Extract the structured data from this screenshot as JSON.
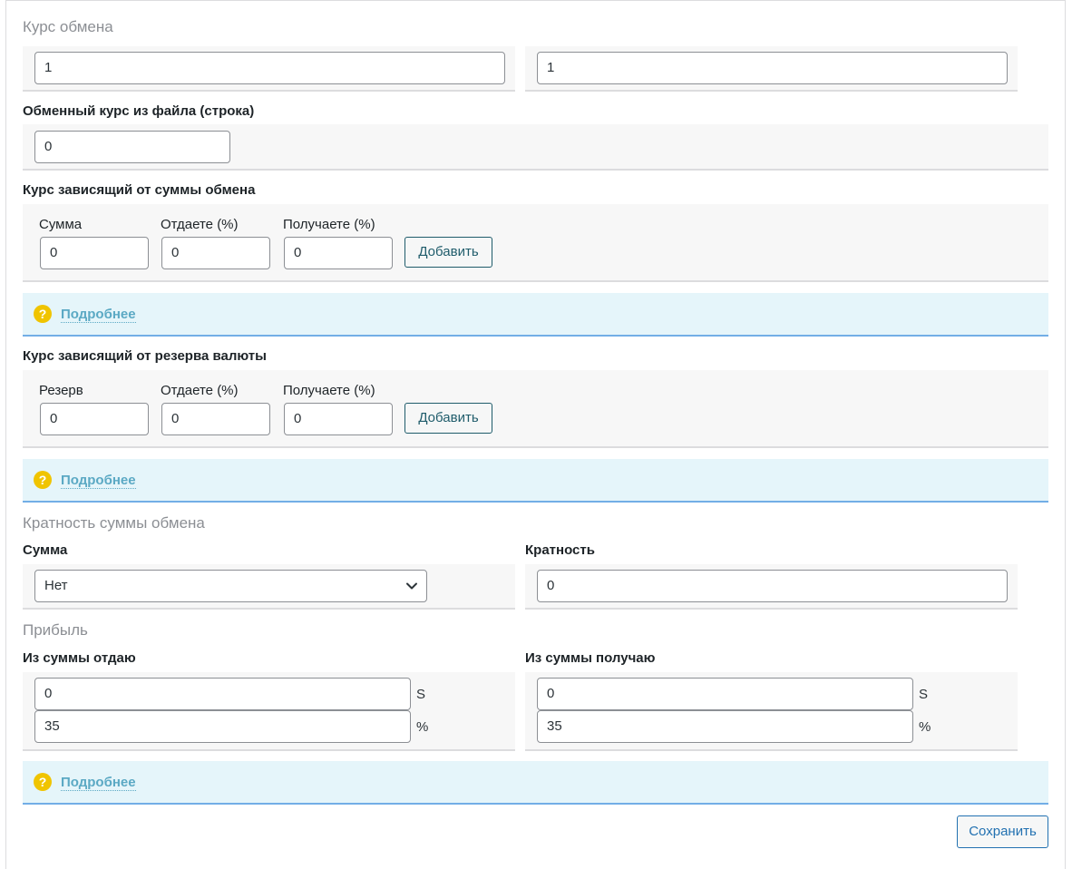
{
  "exchange_rate": {
    "title": "Курс обмена",
    "give_value": "1",
    "get_value": "1"
  },
  "file_rate": {
    "label": "Обменный курс из файла (строка)",
    "value": "0"
  },
  "sum_dependent": {
    "label": "Курс зависящий от суммы обмена",
    "col1": "Сумма",
    "col2": "Отдаете (%)",
    "col3": "Получаете (%)",
    "val1": "0",
    "val2": "0",
    "val3": "0",
    "add_label": "Добавить",
    "help_text": "Подробнее"
  },
  "reserve_dependent": {
    "label": "Курс зависящий от резерва валюты",
    "col1": "Резерв",
    "col2": "Отдаете (%)",
    "col3": "Получаете (%)",
    "val1": "0",
    "val2": "0",
    "val3": "0",
    "add_label": "Добавить",
    "help_text": "Подробнее"
  },
  "multiplicity": {
    "title": "Кратность суммы обмена",
    "sum_label": "Сумма",
    "sum_selected": "Нет",
    "mult_label": "Кратность",
    "mult_value": "0"
  },
  "profit": {
    "title": "Прибыль",
    "give_label": "Из суммы отдаю",
    "get_label": "Из суммы получаю",
    "give_fixed": "0",
    "give_percent": "35",
    "get_fixed": "0",
    "get_percent": "35",
    "unit_fixed": "S",
    "unit_percent": "%",
    "help_text": "Подробнее"
  },
  "save_label": "Сохранить",
  "colors": {
    "accent": "#2271b1",
    "help_icon": "#f0c400",
    "notice_bg": "#e5f5fa",
    "panel_bg": "#f7f7f7"
  },
  "icons": {
    "help": "question-circle-icon",
    "select": "chevron-down-icon"
  }
}
